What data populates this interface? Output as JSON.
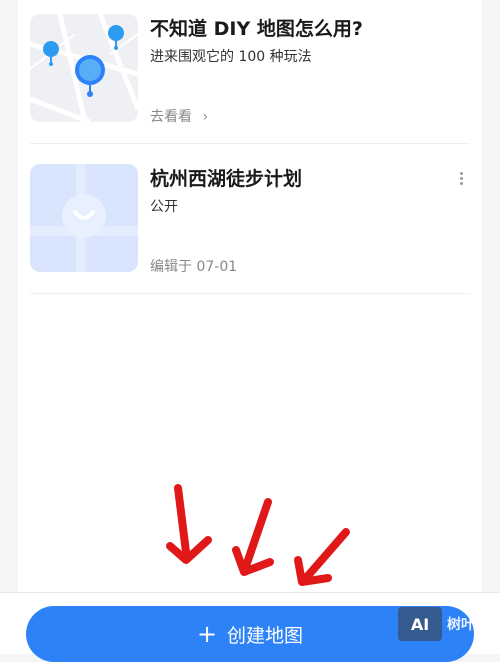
{
  "cards": [
    {
      "title": "不知道 DIY 地图怎么用?",
      "subtitle": "进来围观它的 100 种玩法",
      "link_label": "去看看",
      "link_icon": "chevron-right-icon"
    },
    {
      "title": "杭州西湖徒步计划",
      "subtitle": "公开",
      "meta": "编辑于 07-01",
      "more_icon": "more-vertical-icon"
    }
  ],
  "bottom": {
    "create_label": "创建地图",
    "create_icon": "+"
  },
  "watermark": {
    "logo": "AI",
    "text": "树叶云"
  },
  "colors": {
    "accent": "#2d82f8",
    "arrow": "#e01818"
  }
}
